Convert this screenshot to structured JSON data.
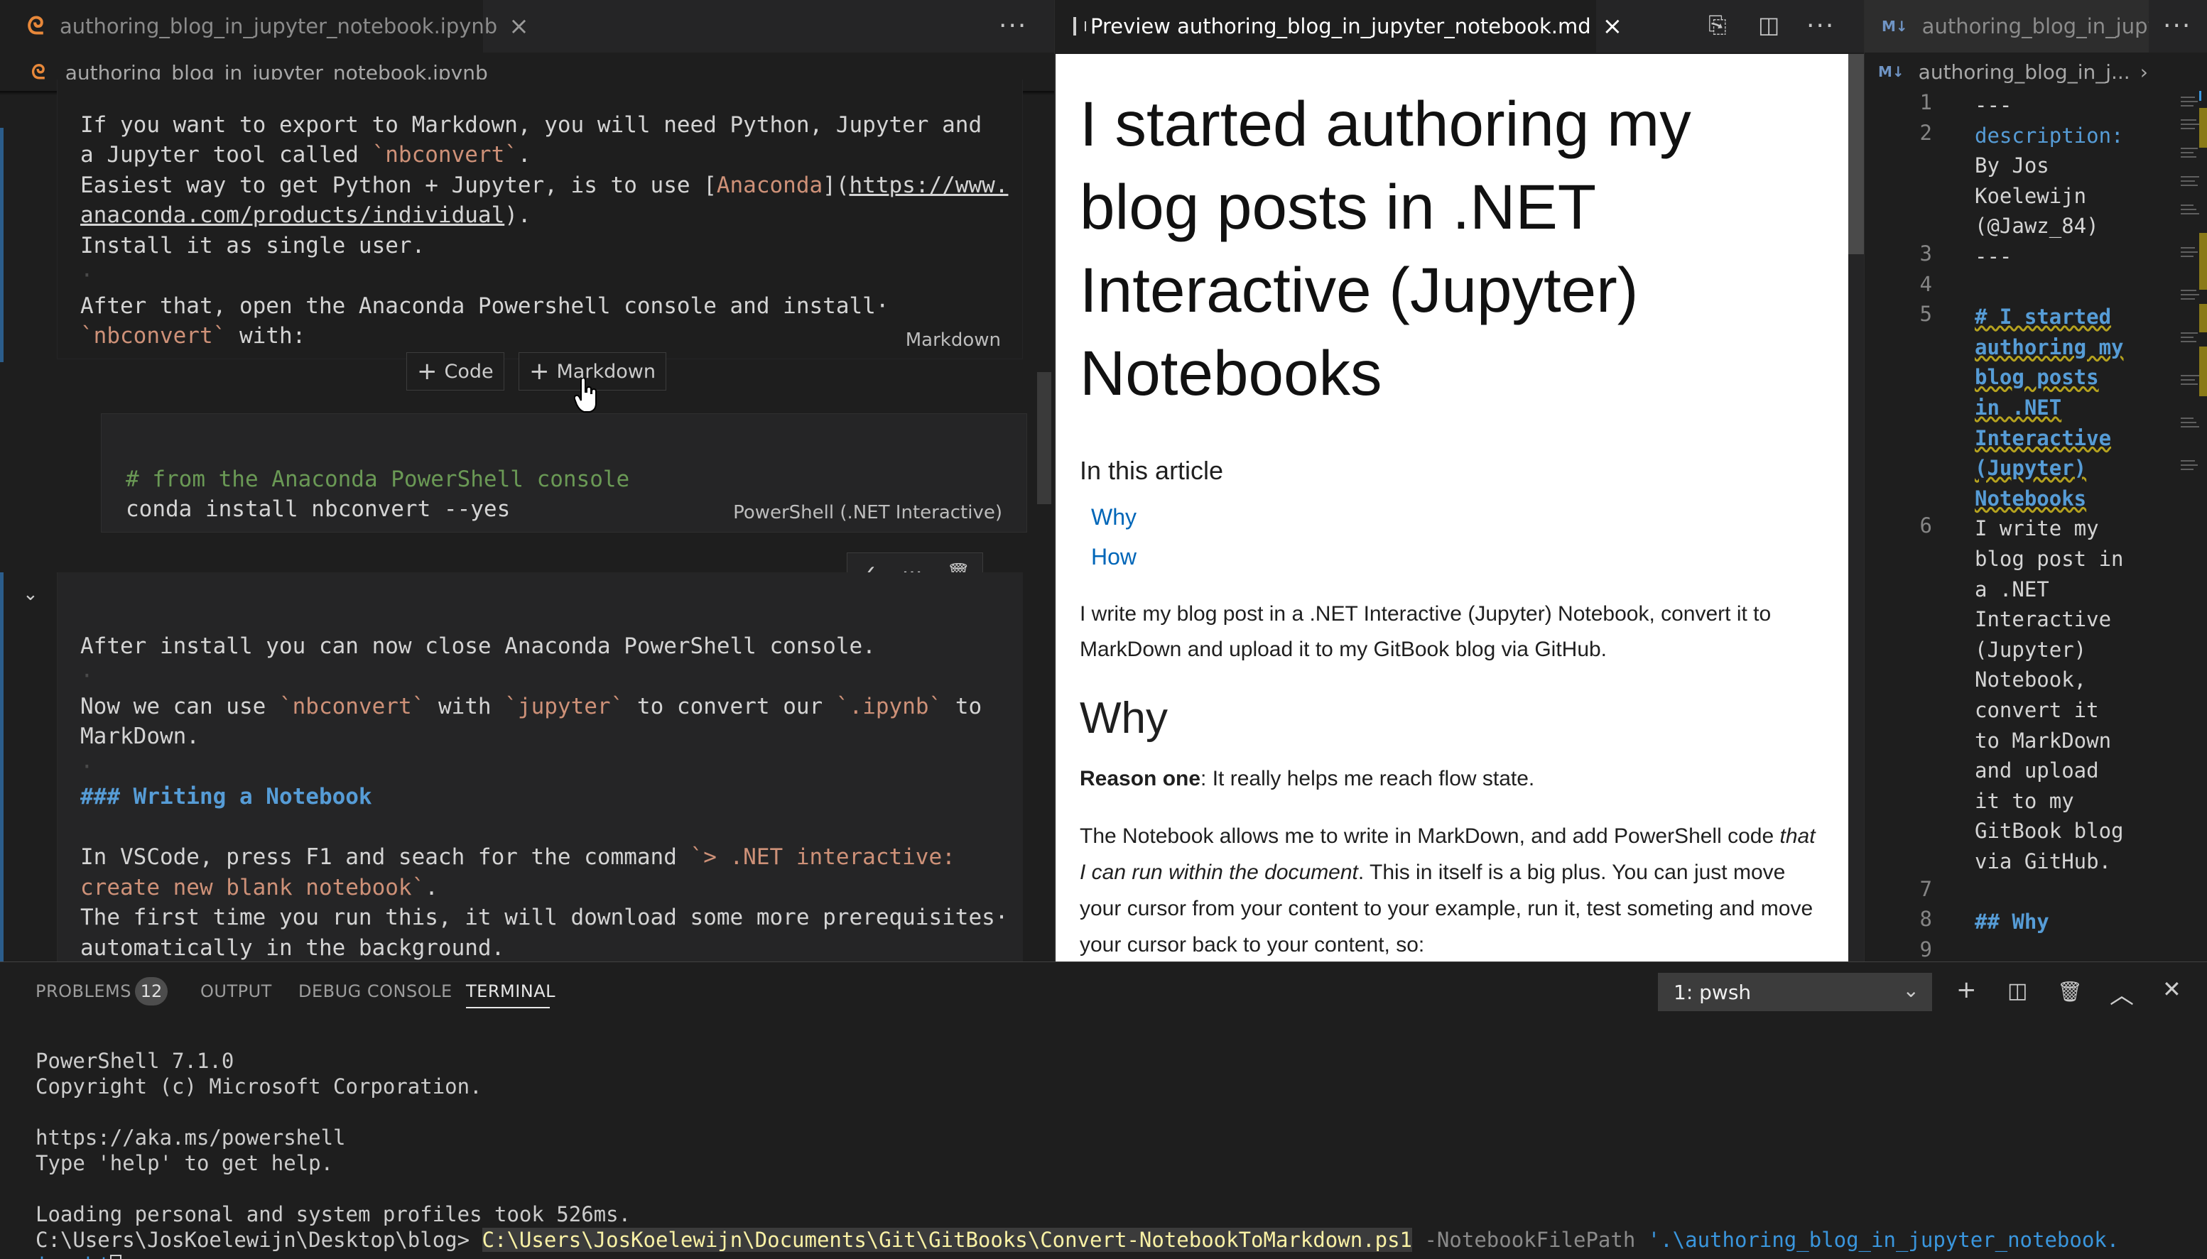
{
  "left_group": {
    "tab_label": "authoring_blog_in_jupyter_notebook.ipynb",
    "breadcrumb": "authoring_blog_in_jupyter_notebook.ipynb",
    "more_label": "···",
    "md_cell_1": {
      "line1": "If you want to export to Markdown, you will need Python, Jupyter and",
      "line2_a": "a Jupyter tool called ",
      "line2_code": "`nbconvert`",
      "line2_b": ".",
      "line3_a": "Easiest way to get Python + Jupyter, is to use [",
      "line3_link": "Anaconda",
      "line3_b": "](",
      "line3_url": "https://www.",
      "line4_url": "anaconda.com/products/individual",
      "line4_b": ").",
      "line5": "Install it as single user.",
      "line6": "·",
      "line7": "After that, open the Anaconda Powershell console and install·",
      "line8_code": "`nbconvert`",
      "line8_b": " with:",
      "kind": "Markdown"
    },
    "insert_code_label": "Code",
    "insert_markdown_label": "Markdown",
    "ps_cell": {
      "comment": "# from the Anaconda PowerShell console",
      "command": "conda install nbconvert --yes",
      "kind": "PowerShell (.NET Interactive)"
    },
    "cell_toolbar": {
      "check": "✓",
      "more": "···",
      "delete": "🗑"
    },
    "md_cell_2": {
      "line1": "After install you can now close Anaconda PowerShell console.",
      "line2": "·",
      "line3_a": "Now we can use ",
      "line3_c1": "`nbconvert`",
      "line3_b": " with ",
      "line3_c2": "`jupyter`",
      "line3_c": " to convert our ",
      "line3_c3": "`.ipynb`",
      "line3_d": " to",
      "line4": "MarkDown.",
      "line5": "·",
      "line6": "### Writing a Notebook",
      "line7": "",
      "line8_a": "In VSCode, press F1 and seach for the command ",
      "line8_code": "`> .NET interactive:",
      "line9_code": "create new blank notebook`",
      "line9_b": ".",
      "line10": "The first time you run this, it will download some more prerequisites·",
      "line11": "automatically in the background."
    }
  },
  "mid_group": {
    "tab_label": "Preview authoring_blog_in_jupyter_notebook.md",
    "title": "I started authoring my blog posts in .NET Interactive (Jupyter) Notebooks",
    "toc_heading": "In this article",
    "toc_items": [
      "Why",
      "How"
    ],
    "intro": "I write my blog post in a .NET Interactive (Jupyter) Notebook, convert it to MarkDown and upload it to my GitBook blog via GitHub.",
    "h2_why": "Why",
    "reason_bold": "Reason one",
    "reason_rest": ": It really helps me reach flow state.",
    "para_a": "The Notebook allows me to write in MarkDown, and add PowerShell code ",
    "para_em": "that I can run within the document",
    "para_b": ". This in itself is a big plus. You can just move your cursor from your content to your example, run it, test someting and move your cursor back to your content, so:",
    "link_color": "#0066b8"
  },
  "right_group": {
    "tab_label": "authoring_blog_in_jupyte",
    "breadcrumb": "authoring_blog_in_j...",
    "lines": [
      {
        "n": "1",
        "t": "---"
      },
      {
        "n": "2",
        "t": "description:"
      },
      {
        "n": "",
        "t": "By Jos"
      },
      {
        "n": "",
        "t": "Koelewijn"
      },
      {
        "n": "",
        "t": "(@Jawz_84)"
      },
      {
        "n": "3",
        "t": "---"
      },
      {
        "n": "4",
        "t": ""
      },
      {
        "n": "5",
        "t": "# I started"
      },
      {
        "n": "",
        "t": "authoring my"
      },
      {
        "n": "",
        "t": "blog posts"
      },
      {
        "n": "",
        "t": "in .NET"
      },
      {
        "n": "",
        "t": "Interactive"
      },
      {
        "n": "",
        "t": "(Jupyter)"
      },
      {
        "n": "",
        "t": "Notebooks"
      },
      {
        "n": "6",
        "t": "I write my"
      },
      {
        "n": "",
        "t": "blog post in"
      },
      {
        "n": "",
        "t": "a .NET"
      },
      {
        "n": "",
        "t": "Interactive"
      },
      {
        "n": "",
        "t": "(Jupyter)"
      },
      {
        "n": "",
        "t": "Notebook,"
      },
      {
        "n": "",
        "t": "convert it"
      },
      {
        "n": "",
        "t": "to MarkDown"
      },
      {
        "n": "",
        "t": "and upload"
      },
      {
        "n": "",
        "t": "it to my"
      },
      {
        "n": "",
        "t": "GitBook blog"
      },
      {
        "n": "",
        "t": "via GitHub."
      },
      {
        "n": "7",
        "t": ""
      },
      {
        "n": "8",
        "t": "## Why"
      },
      {
        "n": "9",
        "t": ""
      }
    ]
  },
  "panel": {
    "tabs": [
      "PROBLEMS",
      "OUTPUT",
      "DEBUG CONSOLE",
      "TERMINAL"
    ],
    "problems_count": "12",
    "terminal_select": "1: pwsh",
    "terminal_lines": [
      "PowerShell 7.1.0",
      "Copyright (c) Microsoft Corporation.",
      "",
      "https://aka.ms/powershell",
      "Type 'help' to get help.",
      "",
      "Loading personal and system profiles took 526ms."
    ],
    "prompt": "C:\\Users\\JosKoelewijn\\Desktop\\blog> ",
    "command_path": "C:\\Users\\JosKoelewijn\\Documents\\Git\\GitBooks\\Convert-NotebookToMarkdown.ps1",
    "param_name": " -NotebookFilePath ",
    "param_value_1": "'.\\authoring_blog_in_jupyter_notebook.",
    "param_value_2": "ipynb'"
  }
}
